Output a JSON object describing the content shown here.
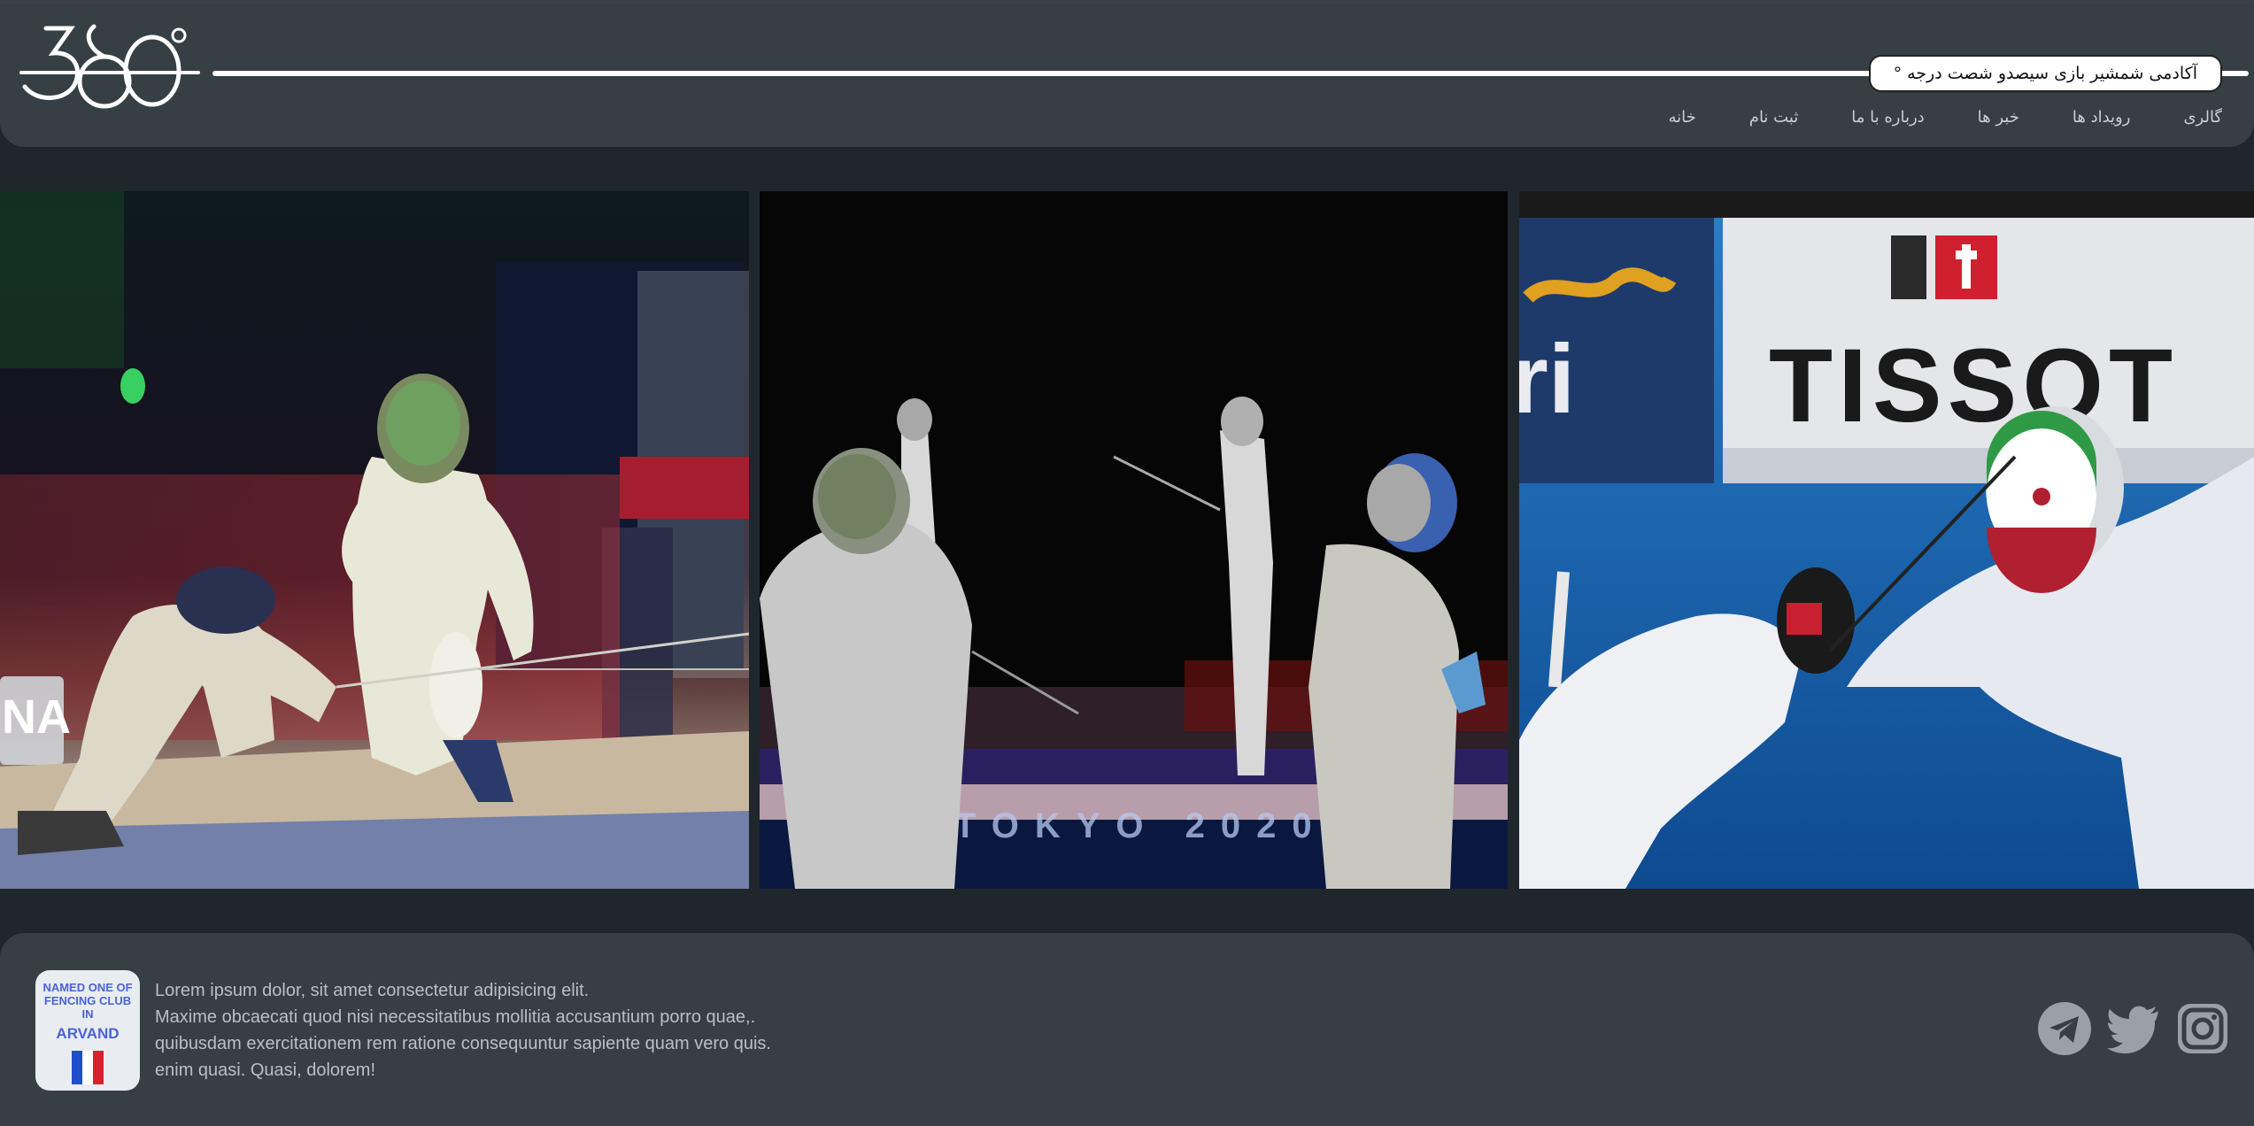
{
  "header": {
    "logo_text": "360°",
    "title": "آکادمی شمشیر بازی سیصدو شصت درجه °",
    "nav": [
      {
        "label": "خانه"
      },
      {
        "label": "ثبت نام"
      },
      {
        "label": "درباره با ما"
      },
      {
        "label": "خبر ها"
      },
      {
        "label": "رویداد ها"
      },
      {
        "label": "گالری"
      }
    ]
  },
  "gallery": {
    "photos": [
      {
        "subject": "fencers-lunge-photo"
      },
      {
        "subject": "fencers-tokyo-photo"
      },
      {
        "subject": "fencers-iran-tissot-photo"
      }
    ],
    "signage": {
      "tokyo": "TOKYO 2020",
      "tissot": "TISSOT",
      "na_sign": "NA"
    }
  },
  "footer": {
    "badge": {
      "line1": "NAMED ONE OF",
      "line2": "FENCING CLUB",
      "line3": "IN",
      "name": "ARVAND"
    },
    "text": [
      "Lorem ipsum dolor, sit amet consectetur adipisicing elit.",
      "Maxime obcaecati quod nisi necessitatibus mollitia accusantium porro quae,.",
      "quibusdam exercitationem rem ratione consequuntur sapiente quam vero quis.",
      "enim quasi. Quasi, dolorem!"
    ],
    "socials": [
      {
        "icon": "telegram-icon"
      },
      {
        "icon": "twitter-icon"
      },
      {
        "icon": "instagram-icon"
      }
    ]
  },
  "colors": {
    "background": "#1f272c",
    "panel": "#353f44",
    "text_muted": "#b9c0c5",
    "badge_blue": "#4a63d8",
    "social_grey": "#9aa1a6"
  }
}
